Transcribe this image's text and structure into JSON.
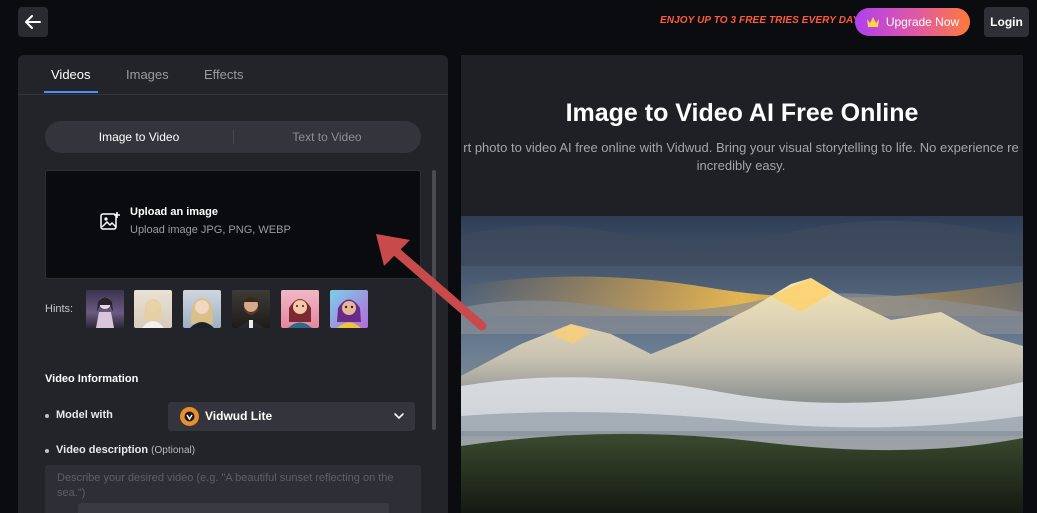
{
  "header": {
    "back_icon": "arrow-left-icon",
    "promo_text": "ENJOY UP TO 3 FREE TRIES EVERY DAY!",
    "upgrade_label": "Upgrade Now",
    "upgrade_icon": "crown-icon",
    "login_label": "Login"
  },
  "tabs": [
    {
      "label": "Videos",
      "active": true
    },
    {
      "label": "Images",
      "active": false
    },
    {
      "label": "Effects",
      "active": false
    }
  ],
  "mode_toggle": {
    "options": [
      "Image to Video",
      "Text to Video"
    ],
    "selected": "Image to Video"
  },
  "upload": {
    "icon": "image-upload-icon",
    "title": "Upload an image",
    "subtitle": "Upload image JPG, PNG, WEBP"
  },
  "hints": {
    "label": "Hints:",
    "thumbnails": [
      "anime-girl",
      "blonde-woman",
      "portrait-woman",
      "bearded-man",
      "cartoon-woman",
      "comic-girl"
    ]
  },
  "video_info": {
    "title": "Video Information",
    "model_label": "Model with",
    "model_value": "Vidwud Lite",
    "description_label": "Video description",
    "description_optional": "(Optional)",
    "description_placeholder": "Describe your desired video (e.g. \"A beautiful sunset reflecting on the sea.\")"
  },
  "hero": {
    "title": "Image to Video AI Free Online",
    "description_line1": "rt photo to video AI free online with Vidwud. Bring your visual storytelling to life. No experience re",
    "description_line2": "incredibly easy."
  },
  "colors": {
    "accent": "#4c8dff",
    "promo": "#ff5a3c",
    "arrow": "#c94a4a"
  }
}
